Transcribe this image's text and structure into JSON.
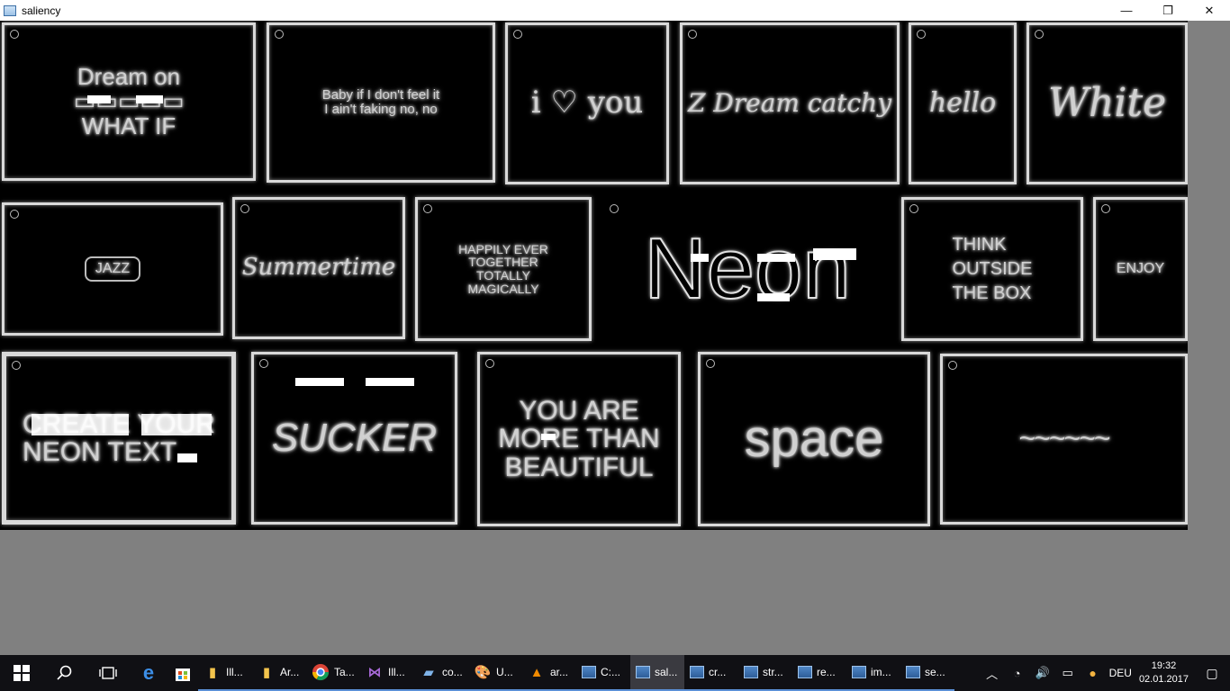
{
  "window": {
    "title": "saliency",
    "controls": {
      "minimize": "—",
      "restore": "❐",
      "close": "✕"
    }
  },
  "tiles": [
    {
      "text": "Dream on\n▭▭▭▭▭\nWHAT IF"
    },
    {
      "text": "Baby if I don't feel it\nI ain't faking no, no"
    },
    {
      "text": "i ♡ you"
    },
    {
      "text": "Z Dream catchy"
    },
    {
      "text": "hello"
    },
    {
      "text": "White"
    },
    {
      "text": "JAZZ"
    },
    {
      "text": "Summertime"
    },
    {
      "text": "HAPPILY EVER\nTOGETHER\nTOTALLY\nMAGICALLY"
    },
    {
      "text": "Neon"
    },
    {
      "text": "THINK\nOUTSIDE\nTHE BOX"
    },
    {
      "text": "ENJOY"
    },
    {
      "text": "CREATE YOUR\nNEON TEXT"
    },
    {
      "text": "SUCKER"
    },
    {
      "text": "YOU ARE\nMORE THAN\nBEAUTIFUL"
    },
    {
      "text": "space"
    },
    {
      "text": "~~~~~~"
    }
  ],
  "taskbar": {
    "apps": [
      {
        "label": "Ill...",
        "icon": "folder-icon"
      },
      {
        "label": "Ar...",
        "icon": "folder-icon"
      },
      {
        "label": "Ta...",
        "icon": "chrome-icon"
      },
      {
        "label": "Ill...",
        "icon": "visual-studio-icon"
      },
      {
        "label": "co...",
        "icon": "notepad-icon"
      },
      {
        "label": "U...",
        "icon": "paint-icon"
      },
      {
        "label": "ar...",
        "icon": "vlc-icon"
      },
      {
        "label": "C:...",
        "icon": "window-icon"
      },
      {
        "label": "sal...",
        "icon": "window-icon"
      },
      {
        "label": "cr...",
        "icon": "window-icon"
      },
      {
        "label": "str...",
        "icon": "window-icon"
      },
      {
        "label": "re...",
        "icon": "window-icon"
      },
      {
        "label": "im...",
        "icon": "window-icon"
      },
      {
        "label": "se...",
        "icon": "window-icon"
      }
    ],
    "language": "DEU",
    "time": "19:32",
    "date": "02.01.2017"
  }
}
